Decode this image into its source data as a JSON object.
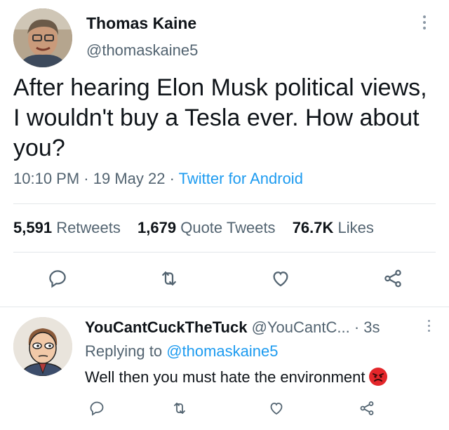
{
  "tweet": {
    "author_name": "Thomas Kaine",
    "author_handle": "@thomaskaine5",
    "text": "After hearing Elon Musk political views, I wouldn't buy a Tesla ever. How about you?",
    "time": "10:10 PM",
    "separator": " · ",
    "date": "19 May 22",
    "source": "Twitter for Android",
    "stats": {
      "retweets_count": "5,591",
      "retweets_label": "Retweets",
      "quotes_count": "1,679",
      "quotes_label": "Quote Tweets",
      "likes_count": "76.7K",
      "likes_label": "Likes"
    },
    "icons": [
      "reply-icon",
      "retweet-icon",
      "like-icon",
      "share-icon"
    ]
  },
  "reply": {
    "author_name": "YouCantCuckTheTuck",
    "author_handle": "@YouCantC...",
    "time": "· 3s",
    "replying_prefix": "Replying to ",
    "replying_to": "@thomaskaine5",
    "text": "Well then you must hate the environment",
    "emoji": "angry-face-emoji"
  },
  "colors": {
    "text": "#0f1419",
    "secondary": "#536471",
    "accent": "#1d9bf0",
    "icon": "#536471"
  }
}
